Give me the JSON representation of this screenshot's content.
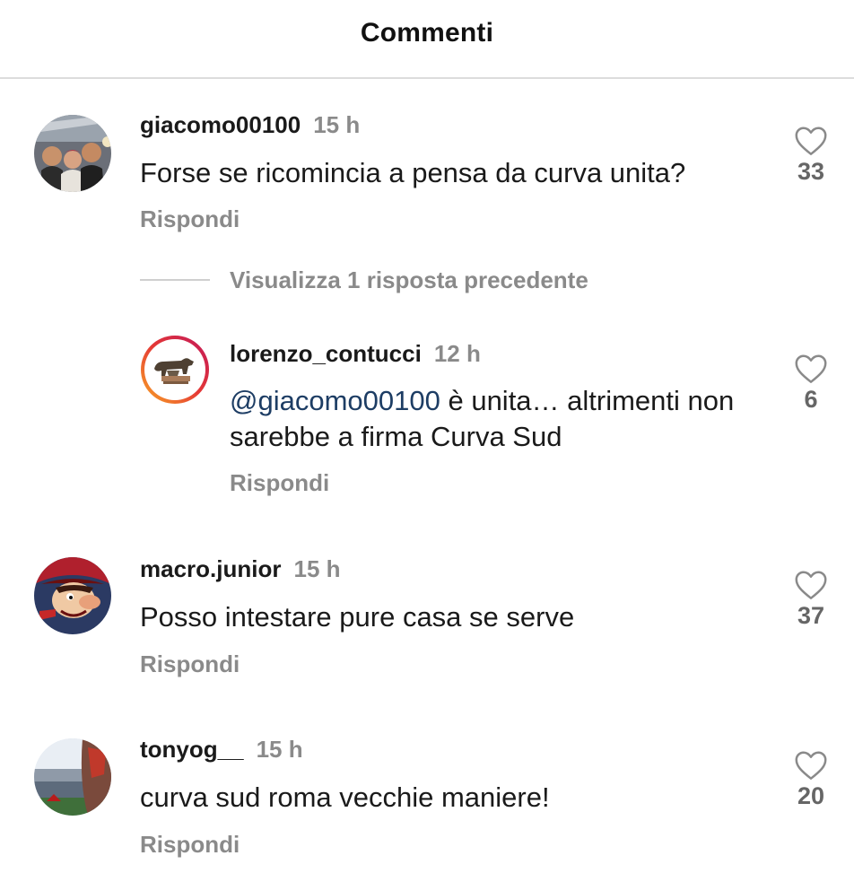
{
  "header": {
    "title": "Commenti"
  },
  "comments": [
    {
      "username": "giacomo00100",
      "time": "15 h",
      "text": "Forse se ricomincia a pensa da curva unita?",
      "reply_label": "Rispondi",
      "likes": "33",
      "avatar": "group-selfie-photo"
    },
    {
      "username": "macro.junior",
      "time": "15 h",
      "text": "Posso intestare pure casa se serve",
      "reply_label": "Rispondi",
      "likes": "37",
      "avatar": "cartoon-character"
    },
    {
      "username": "tonyog__",
      "time": "15 h",
      "text": "curva sud roma vecchie maniere!",
      "reply_label": "Rispondi",
      "likes": "20",
      "avatar": "stadium-photo"
    }
  ],
  "thread": {
    "view_replies_label": "Visualizza 1 risposta precedente",
    "reply": {
      "username": "lorenzo_contucci",
      "time": "12 h",
      "mention": "@giacomo00100",
      "text_line1": " è unita… altrimenti non",
      "text_line2": "sarebbe a firma Curva Sud",
      "reply_label": "Rispondi",
      "likes": "6",
      "avatar": "she-wolf-statue"
    }
  },
  "icons": {
    "like": "heart-icon"
  },
  "colors": {
    "mention": "#1d3d64",
    "story_ring_start": "#f9a825",
    "story_ring_end": "#c2185b"
  }
}
